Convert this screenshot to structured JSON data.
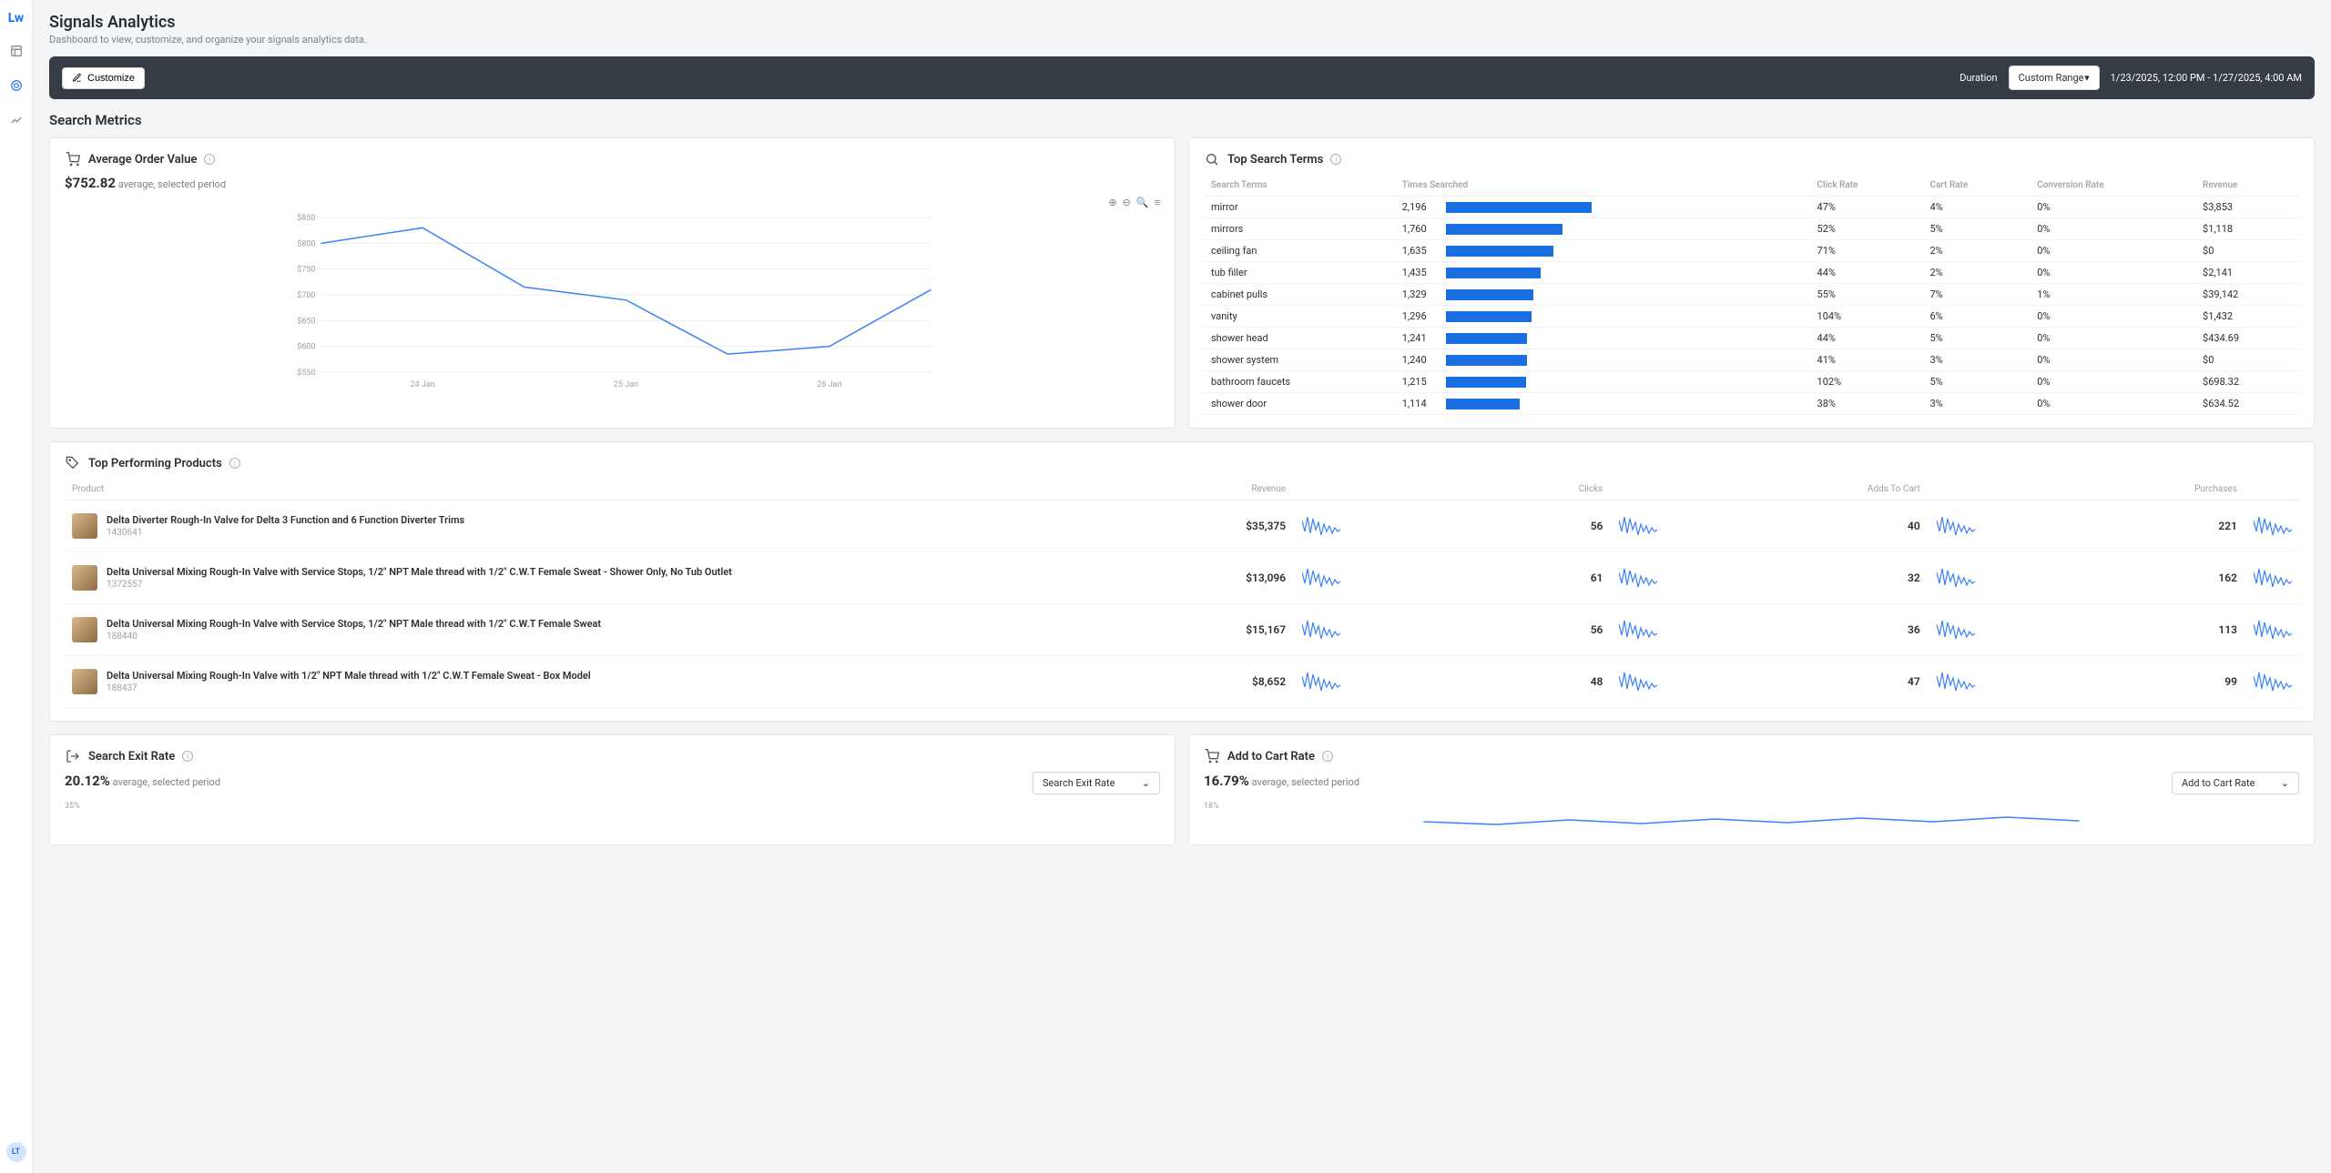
{
  "logo": {
    "initials": "Lw"
  },
  "sidebar": {
    "avatar": "LT"
  },
  "page": {
    "title": "Signals Analytics",
    "subtitle": "Dashboard to view, customize, and organize your signals analytics data."
  },
  "toolbar": {
    "customize": "Customize",
    "duration_label": "Duration",
    "range_select": "Custom Range",
    "range_text": "1/23/2025, 12:00 PM - 1/27/2025, 4:00 AM"
  },
  "section_search_metrics": "Search Metrics",
  "aov": {
    "title": "Average Order Value",
    "value": "$752.82",
    "suffix": "average, selected period"
  },
  "top_terms": {
    "title": "Top Search Terms",
    "columns": [
      "Search Terms",
      "Times Searched",
      "Click Rate",
      "Cart Rate",
      "Conversion Rate",
      "Revenue"
    ],
    "rows": [
      {
        "term": "mirror",
        "times": "2,196",
        "bar": 100,
        "click": "47%",
        "cart": "4%",
        "conv": "0%",
        "rev": "$3,853"
      },
      {
        "term": "mirrors",
        "times": "1,760",
        "bar": 80,
        "click": "52%",
        "cart": "5%",
        "conv": "0%",
        "rev": "$1,118"
      },
      {
        "term": "ceiling fan",
        "times": "1,635",
        "bar": 74,
        "click": "71%",
        "cart": "2%",
        "conv": "0%",
        "rev": "$0"
      },
      {
        "term": "tub filler",
        "times": "1,435",
        "bar": 65,
        "click": "44%",
        "cart": "2%",
        "conv": "0%",
        "rev": "$2,141"
      },
      {
        "term": "cabinet pulls",
        "times": "1,329",
        "bar": 60,
        "click": "55%",
        "cart": "7%",
        "conv": "1%",
        "rev": "$39,142"
      },
      {
        "term": "vanity",
        "times": "1,296",
        "bar": 59,
        "click": "104%",
        "cart": "6%",
        "conv": "0%",
        "rev": "$1,432"
      },
      {
        "term": "shower head",
        "times": "1,241",
        "bar": 56,
        "click": "44%",
        "cart": "5%",
        "conv": "0%",
        "rev": "$434.69"
      },
      {
        "term": "shower system",
        "times": "1,240",
        "bar": 56,
        "click": "41%",
        "cart": "3%",
        "conv": "0%",
        "rev": "$0"
      },
      {
        "term": "bathroom faucets",
        "times": "1,215",
        "bar": 55,
        "click": "102%",
        "cart": "5%",
        "conv": "0%",
        "rev": "$698.32"
      },
      {
        "term": "shower door",
        "times": "1,114",
        "bar": 51,
        "click": "38%",
        "cart": "3%",
        "conv": "0%",
        "rev": "$634.52"
      }
    ]
  },
  "top_products": {
    "title": "Top Performing Products",
    "columns": [
      "Product",
      "Revenue",
      "Clicks",
      "Adds To Cart",
      "Purchases"
    ],
    "rows": [
      {
        "name": "Delta Diverter Rough-In Valve for Delta 3 Function and 6 Function Diverter Trims",
        "sku": "1430641",
        "rev": "$35,375",
        "clicks": "56",
        "adds": "40",
        "purch": "221"
      },
      {
        "name": "Delta Universal Mixing Rough-In Valve with Service Stops, 1/2\" NPT Male thread with 1/2\" C.W.T Female Sweat - Shower Only, No Tub Outlet",
        "sku": "1372557",
        "rev": "$13,096",
        "clicks": "61",
        "adds": "32",
        "purch": "162"
      },
      {
        "name": "Delta Universal Mixing Rough-In Valve with Service Stops, 1/2\" NPT Male thread with 1/2\" C.W.T Female Sweat",
        "sku": "188440",
        "rev": "$15,167",
        "clicks": "56",
        "adds": "36",
        "purch": "113"
      },
      {
        "name": "Delta Universal Mixing Rough-In Valve with 1/2\" NPT Male thread with 1/2\" C.W.T Female Sweat - Box Model",
        "sku": "188437",
        "rev": "$8,652",
        "clicks": "48",
        "adds": "47",
        "purch": "99"
      }
    ]
  },
  "exit_rate": {
    "title": "Search Exit Rate",
    "value": "20.12%",
    "suffix": "average, selected period",
    "select": "Search Exit Rate",
    "ytick": "35%"
  },
  "cart_rate": {
    "title": "Add to Cart Rate",
    "value": "16.79%",
    "suffix": "average, selected period",
    "select": "Add to Cart Rate",
    "ytick": "18%"
  },
  "chart_data": {
    "aov_line": {
      "type": "line",
      "title": "Average Order Value",
      "ylabel": "$",
      "ylim": [
        550,
        850
      ],
      "yticks": [
        "$850",
        "$800",
        "$750",
        "$700",
        "$650",
        "$600",
        "$550"
      ],
      "xticks": [
        "24 Jan",
        "25 Jan",
        "26 Jan"
      ],
      "values": [
        800,
        830,
        715,
        690,
        585,
        600,
        710
      ]
    }
  }
}
